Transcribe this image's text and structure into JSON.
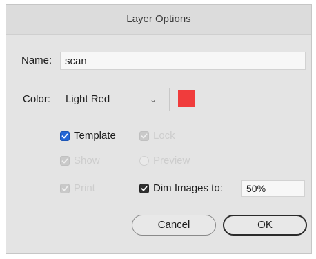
{
  "dialog": {
    "title": "Layer Options"
  },
  "name": {
    "label": "Name:",
    "value": "scan"
  },
  "color": {
    "label": "Color:",
    "selected": "Light Red",
    "swatch_hex": "#f03c3c"
  },
  "options": {
    "template": {
      "label": "Template",
      "checked": true
    },
    "lock": {
      "label": "Lock",
      "checked": true,
      "enabled": false
    },
    "show": {
      "label": "Show",
      "checked": true,
      "enabled": false
    },
    "preview": {
      "label": "Preview",
      "selected": false,
      "enabled": false
    },
    "print": {
      "label": "Print",
      "checked": true,
      "enabled": false
    },
    "dim_images": {
      "label": "Dim Images to:",
      "checked": true,
      "value": "50%"
    }
  },
  "buttons": {
    "cancel": "Cancel",
    "ok": "OK"
  },
  "colors": {
    "checkbox_accent": "#2467d6",
    "dialog_bg": "#e4e4e4"
  }
}
